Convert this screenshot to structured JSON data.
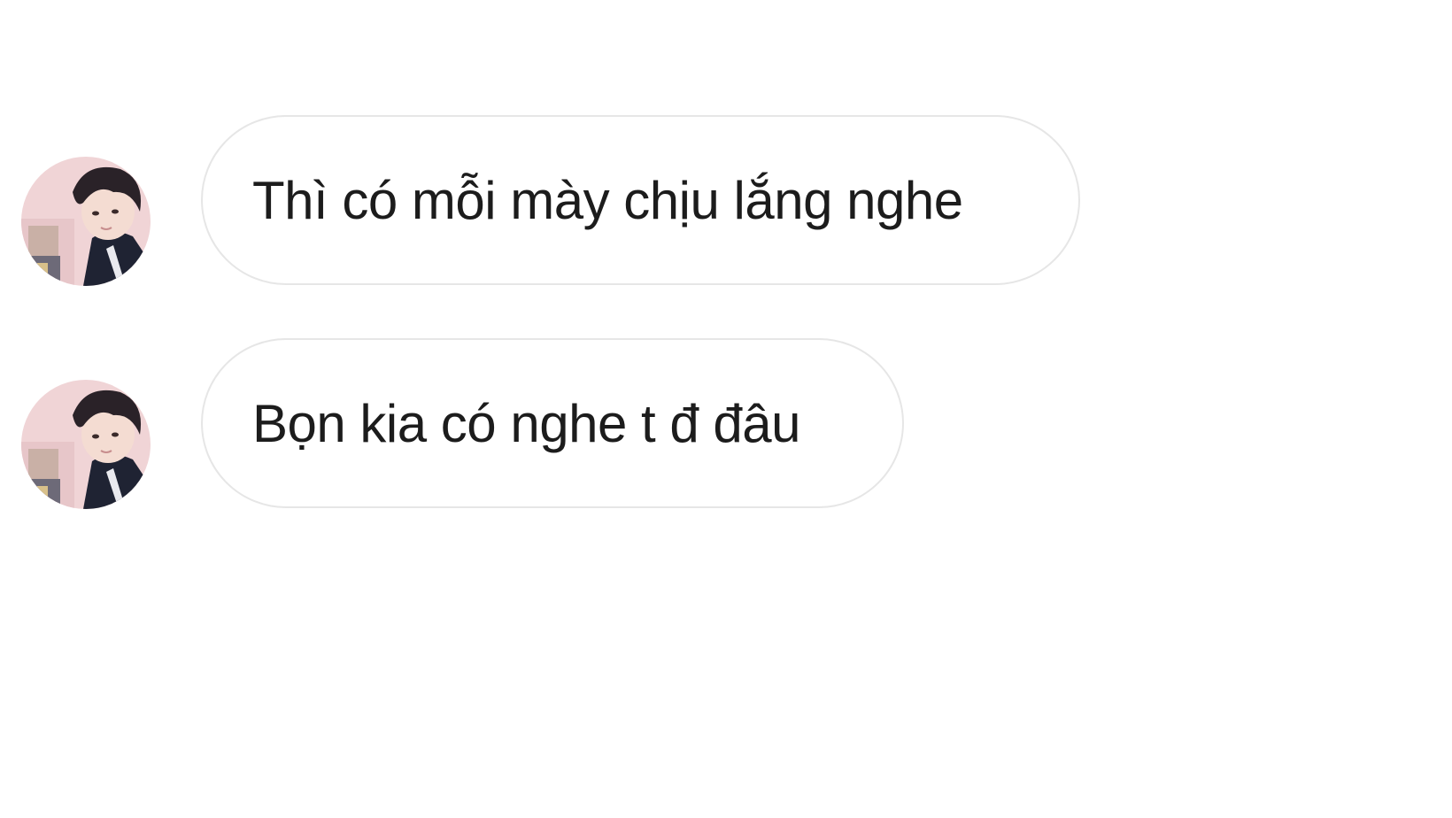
{
  "conversation": {
    "messages": [
      {
        "text": "Thì có mỗi mày chịu lắng nghe",
        "avatar_icon": "user-avatar-icon"
      },
      {
        "text": "Bọn kia có nghe t đ đâu",
        "avatar_icon": "user-avatar-icon"
      }
    ]
  },
  "colors": {
    "background": "#ffffff",
    "bubble_border": "#e6e6e6",
    "bubble_text": "#1c1c1c"
  }
}
